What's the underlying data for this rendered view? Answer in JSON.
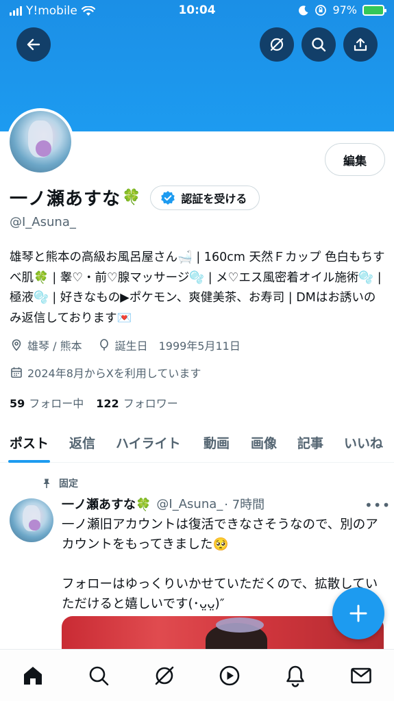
{
  "status_bar": {
    "carrier": "Y!mobile",
    "time": "10:04",
    "battery": "97%"
  },
  "header_icons": [
    "back-arrow-icon",
    "grok-icon",
    "search-icon",
    "share-icon"
  ],
  "profile": {
    "edit_label": "編集",
    "display_name": "一ノ瀬あすな",
    "name_emoji": "🍀",
    "verify_label": "認証を受ける",
    "handle": "@I_Asuna_",
    "bio": "雄琴と熊本の高級お風呂屋さん🛁 | 160cm 天然Ｆカップ 色白もちすべ肌🍀 | 睾♡・前♡腺マッサージ🫧 | メ♡エス風密着オイル施術🫧 | 極液🫧 | 好きなもの▶︎ポケモン、爽健美茶、お寿司 | DMはお誘いのみ返信しております💌",
    "location": "雄琴 / 熊本",
    "birthday": "誕生日　1999年5月11日",
    "joined": "2024年8月からXを利用しています",
    "following_count": "59",
    "following_label": "フォロー中",
    "followers_count": "122",
    "followers_label": "フォロワー"
  },
  "tabs": [
    {
      "label": "ポスト",
      "active": true
    },
    {
      "label": "返信",
      "active": false
    },
    {
      "label": "ハイライト",
      "active": false
    },
    {
      "label": "動画",
      "active": false
    },
    {
      "label": "画像",
      "active": false
    },
    {
      "label": "記事",
      "active": false
    },
    {
      "label": "いいね",
      "active": false
    }
  ],
  "pinned_post": {
    "pinned_label": "固定",
    "author_name": "一ノ瀬あすな🍀",
    "author_handle": "@I_Asuna_",
    "time": "· 7時間",
    "more": "•••",
    "text": "一ノ瀬旧アカウントは復活できなさそうなので、別のアカウントをもってきました🥺\n\nフォローはゆっくりいかせていただくので、拡散していただけると嬉しいです(･ᴗ̤ᴗ̤)″"
  },
  "bottom_nav": [
    "home-icon",
    "search-icon",
    "grok-icon",
    "video-icon",
    "notifications-icon",
    "messages-icon"
  ],
  "colors": {
    "accent": "#1d9bf0",
    "text": "#0f1419",
    "secondary_text": "#536471",
    "verified_badge": "#1d9bf0"
  }
}
